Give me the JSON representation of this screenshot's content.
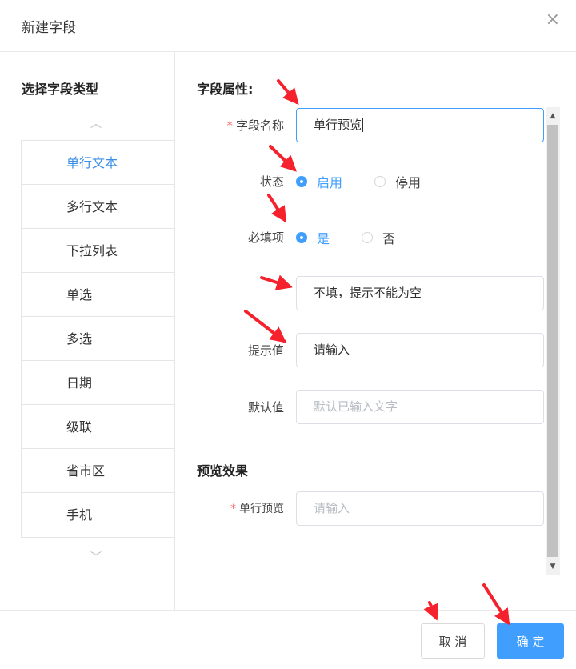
{
  "dialog": {
    "title": "新建字段",
    "close_icon": "×"
  },
  "left_panel": {
    "title": "选择字段类型",
    "scroll_up": "︿",
    "scroll_down": "﹀",
    "items": [
      {
        "label": "单行文本",
        "active": true
      },
      {
        "label": "多行文本"
      },
      {
        "label": "下拉列表"
      },
      {
        "label": "单选"
      },
      {
        "label": "多选"
      },
      {
        "label": "日期"
      },
      {
        "label": "级联"
      },
      {
        "label": "省市区"
      },
      {
        "label": "手机"
      }
    ]
  },
  "properties": {
    "section_title": "字段属性:",
    "field_name": {
      "label": "字段名称",
      "required_mark": "*",
      "value": "单行预览"
    },
    "status": {
      "label": "状态",
      "options": [
        "启用",
        "停用"
      ],
      "selected": "启用"
    },
    "required": {
      "label": "必填项",
      "options": [
        "是",
        "否"
      ],
      "selected": "是"
    },
    "required_message": {
      "value": "不填，提示不能为空"
    },
    "hint": {
      "label": "提示值",
      "value": "请输入"
    },
    "default": {
      "label": "默认值",
      "placeholder": "默认已输入文字"
    }
  },
  "preview": {
    "section_title": "预览效果",
    "field": {
      "label": "单行预览",
      "required_mark": "*",
      "placeholder": "请输入"
    }
  },
  "footer": {
    "cancel_label": "取 消",
    "ok_label": "确 定"
  },
  "colors": {
    "accent": "#409eff",
    "annotation_arrow": "#f5222d",
    "required": "#f56c6c"
  }
}
